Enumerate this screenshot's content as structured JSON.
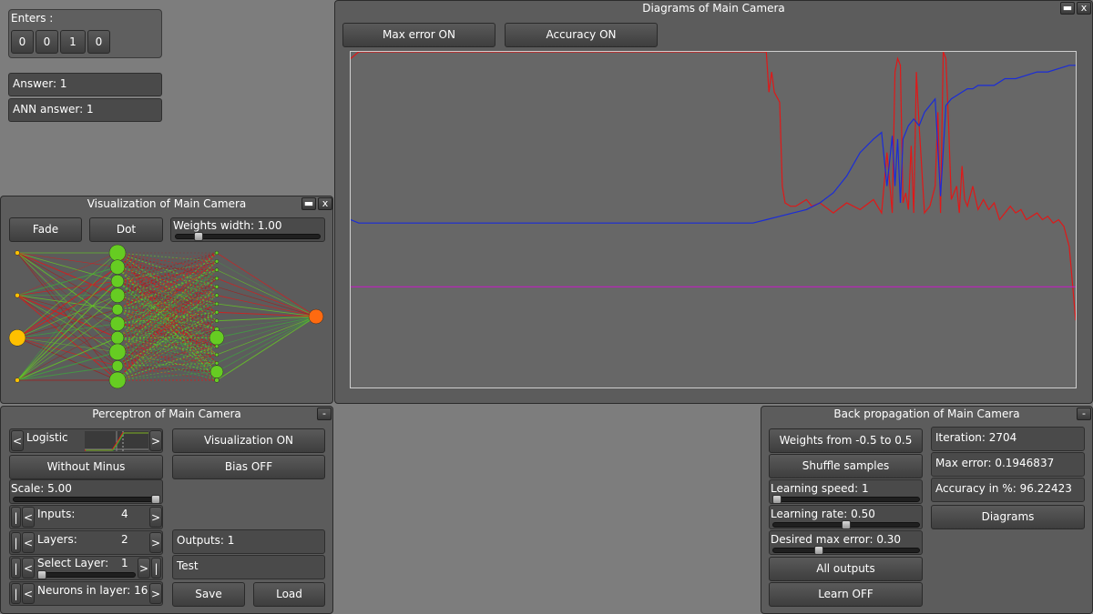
{
  "enters": {
    "title": "Enters :",
    "values": [
      "0",
      "0",
      "1",
      "0"
    ]
  },
  "answer": "Answer: 1",
  "ann_answer": "ANN answer: 1",
  "visualization": {
    "title": "Visualization of Main Camera",
    "minimize": "▬",
    "close": "x",
    "fade_label": "Fade",
    "dot_label": "Dot",
    "weights_width": "Weights width: 1.00",
    "weights_width_level": 0.08
  },
  "diagrams": {
    "title": "Diagrams of Main Camera",
    "minimize": "▬",
    "close": "x",
    "max_error_label": "Max error ON",
    "accuracy_label": "Accuracy ON"
  },
  "perceptron": {
    "title": "Perceptron of Main Camera",
    "minimize": "-",
    "function_name": "Logistic",
    "prev": "<",
    "next": ">",
    "edge": "|",
    "without_minus": "Without Minus",
    "visualization_on": "Visualization ON",
    "bias_off": "Bias OFF",
    "scale": "Scale: 5.00",
    "scale_level": 1.0,
    "inputs_label": "Inputs:",
    "inputs_value": "4",
    "layers_label": "Layers:",
    "layers_value": "2",
    "select_layer_label": "Select Layer:",
    "select_layer_value": "1",
    "select_layer_level": 0.0,
    "neurons_label": "Neurons in layer: 16",
    "outputs": "Outputs: 1",
    "test": "Test",
    "save": "Save",
    "load": "Load"
  },
  "backprop": {
    "title": "Back propagation of Main Camera",
    "minimize": "-",
    "weights_from": "Weights from -0.5 to 0.5",
    "shuffle": "Shuffle samples",
    "learning_speed": "Learning speed: 1",
    "learning_speed_level": 0.0,
    "learning_rate": "Learning rate: 0.50",
    "learning_rate_level": 0.5,
    "desired_max_error": "Desired max error: 0.30",
    "desired_max_error_level": 0.3,
    "all_outputs": "All outputs",
    "learn_off": "Learn OFF",
    "iteration": "Iteration: 2704",
    "max_error": "Max error: 0.1946837",
    "accuracy": "Accuracy in %: 96.22423",
    "diagrams_button": "Diagrams"
  },
  "colors": {
    "error_line": "#e01818",
    "accuracy_line": "#1a2cd8",
    "threshold_line": "#c020c0",
    "input_neuron": "#ffc000",
    "hidden_neuron": "#66cc22",
    "output_neuron": "#ff6a10"
  },
  "network": {
    "input_sizes": [
      5,
      5,
      18,
      5
    ],
    "hidden1_sizes": [
      18,
      16,
      14,
      16,
      12,
      16,
      14,
      18,
      12,
      18
    ],
    "hidden2_sizes": [
      4,
      4,
      4,
      4,
      4,
      4,
      4,
      4,
      4,
      5,
      16,
      4,
      4,
      4,
      14,
      5
    ],
    "output_sizes": [
      16
    ]
  },
  "chart_data": {
    "type": "line",
    "x_range": [
      0,
      2704
    ],
    "ylim": [
      0,
      1
    ],
    "grid": false,
    "series": [
      {
        "color": "#e01818",
        "x": [
          0,
          30,
          1500,
          1550,
          1560,
          1570,
          1580,
          1600,
          1610,
          1620,
          1640,
          1660,
          1680,
          1700,
          1720,
          1750,
          1800,
          1850,
          1900,
          1950,
          1980,
          2000,
          2020,
          2030,
          2040,
          2050,
          2060,
          2070,
          2080,
          2090,
          2100,
          2110,
          2120,
          2140,
          2160,
          2180,
          2190,
          2200,
          2210,
          2220,
          2230,
          2240,
          2260,
          2270,
          2280,
          2290,
          2300,
          2320,
          2340,
          2360,
          2380,
          2400,
          2420,
          2440,
          2460,
          2480,
          2500,
          2520,
          2540,
          2560,
          2580,
          2600,
          2620,
          2640,
          2660,
          2680,
          2704
        ],
        "y": [
          0.98,
          1.0,
          1.0,
          1.0,
          0.88,
          0.94,
          0.88,
          0.85,
          0.6,
          0.55,
          0.54,
          0.54,
          0.55,
          0.56,
          0.54,
          0.55,
          0.52,
          0.55,
          0.53,
          0.56,
          0.52,
          0.7,
          0.52,
          0.94,
          0.98,
          0.96,
          0.55,
          0.58,
          0.53,
          0.72,
          0.52,
          0.94,
          0.78,
          0.52,
          0.54,
          0.6,
          0.82,
          0.52,
          1.0,
          0.98,
          0.78,
          0.56,
          0.6,
          0.52,
          0.66,
          0.56,
          0.54,
          0.6,
          0.53,
          0.56,
          0.53,
          0.55,
          0.5,
          0.52,
          0.54,
          0.52,
          0.53,
          0.5,
          0.51,
          0.52,
          0.5,
          0.51,
          0.49,
          0.5,
          0.48,
          0.42,
          0.2
        ]
      },
      {
        "color": "#1a2cd8",
        "x": [
          0,
          30,
          1500,
          1550,
          1600,
          1650,
          1700,
          1750,
          1800,
          1850,
          1900,
          1950,
          1980,
          2000,
          2020,
          2030,
          2040,
          2050,
          2060,
          2080,
          2100,
          2120,
          2140,
          2160,
          2180,
          2200,
          2220,
          2240,
          2260,
          2280,
          2300,
          2320,
          2340,
          2360,
          2400,
          2440,
          2480,
          2520,
          2560,
          2600,
          2640,
          2680,
          2704
        ],
        "y": [
          0.5,
          0.49,
          0.49,
          0.5,
          0.51,
          0.52,
          0.53,
          0.55,
          0.58,
          0.63,
          0.7,
          0.74,
          0.76,
          0.6,
          0.75,
          0.6,
          0.74,
          0.55,
          0.74,
          0.78,
          0.8,
          0.78,
          0.82,
          0.84,
          0.86,
          0.57,
          0.84,
          0.86,
          0.87,
          0.88,
          0.89,
          0.89,
          0.9,
          0.9,
          0.9,
          0.92,
          0.92,
          0.93,
          0.94,
          0.94,
          0.95,
          0.96,
          0.96
        ]
      },
      {
        "color": "#c020c0",
        "x": [
          0,
          2704
        ],
        "y": [
          0.3,
          0.3
        ]
      }
    ]
  }
}
